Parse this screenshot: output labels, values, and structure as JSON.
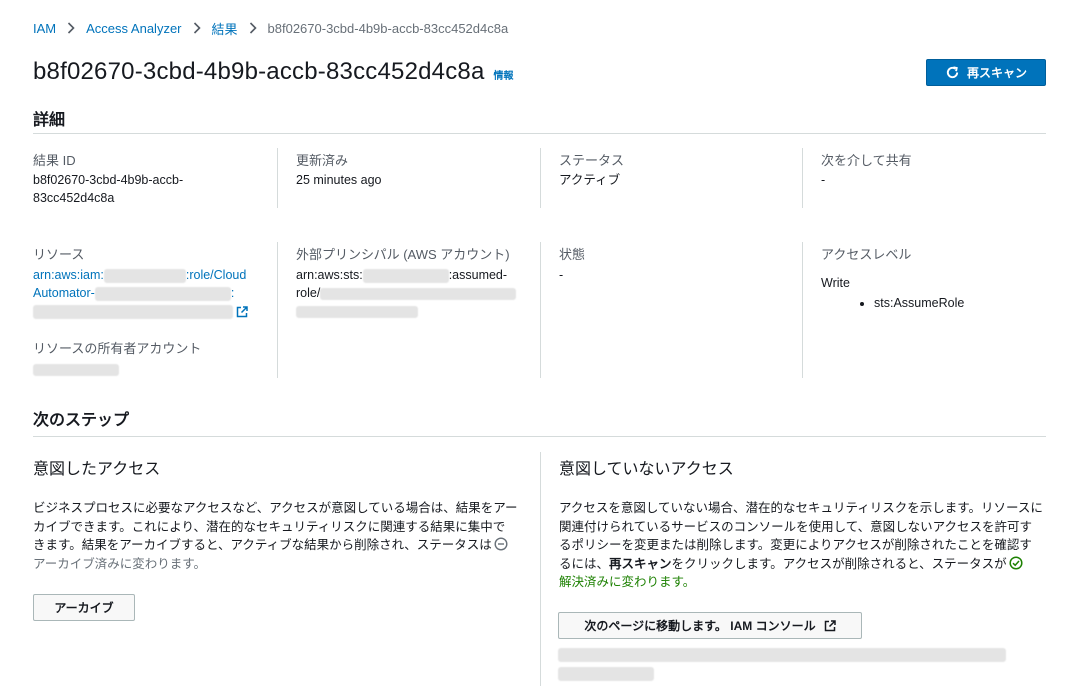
{
  "breadcrumb": {
    "items": [
      "IAM",
      "Access Analyzer",
      "結果"
    ],
    "current": "b8f02670-3cbd-4b9b-accb-83cc452d4c8a"
  },
  "header": {
    "title": "b8f02670-3cbd-4b9b-accb-83cc452d4c8a",
    "info": "情報",
    "rescan": "再スキャン"
  },
  "details": {
    "section_title": "詳細",
    "finding_id_label": "結果 ID",
    "finding_id_line1": "b8f02670-3cbd-4b9b-accb-",
    "finding_id_line2": "83cc452d4c8a",
    "updated_label": "更新済み",
    "updated_value": "25 minutes ago",
    "status_label": "ステータス",
    "status_value": "アクティブ",
    "shared_label": "次を介して共有",
    "shared_value": "-",
    "resource_label": "リソース",
    "resource_prefix": "arn:aws:iam:",
    "resource_mid": ":role/Cloud",
    "resource_line2": "Automator-",
    "resource_colon": ":",
    "owner_label": "リソースの所有者アカウント",
    "principal_label": "外部プリンシパル (AWS アカウント)",
    "principal_prefix": "arn:aws:sts:",
    "principal_mid": ":assumed-",
    "principal_line2": "role/",
    "condition_label": "状態",
    "condition_value": "-",
    "access_label": "アクセスレベル",
    "access_value": "Write",
    "access_items": [
      "sts:AssumeRole"
    ]
  },
  "next_steps": {
    "section_title": "次のステップ",
    "intended": {
      "title": "意図したアクセス",
      "line1": "ビジネスプロセスに必要なアクセスなど、アクセスが意図している場合は、結果をアー",
      "line2": "カイブできます。これにより、潜在的なセキュリティリスクに関連する結果に集中で",
      "line3": "きます。結果をアーカイブすると、アクティブな結果から削除され、ステータスは",
      "line4": "アーカイブ済みに変わります。",
      "button": "アーカイブ"
    },
    "unintended": {
      "title": "意図していないアクセス",
      "line1": "アクセスを意図していない場合、潜在的なセキュリティリスクを示します。リソースに",
      "line2": "関連付けられているサービスのコンソールを使用して、意図しないアクセスを許可す",
      "line3": "るポリシーを変更または削除します。変更によりアクセスが削除されたことを確認す",
      "line4_pre": "るには、",
      "line4_bold": "再スキャン",
      "line4_post": "をクリックします。アクセスが削除されると、ステータスが",
      "line5": "解決済みに変わります。",
      "button": "次のページに移動します。 IAM コンソール"
    }
  },
  "colors": {
    "link": "#0073bb",
    "primary_button": "#0073bb",
    "resolved_green": "#1d8102"
  }
}
